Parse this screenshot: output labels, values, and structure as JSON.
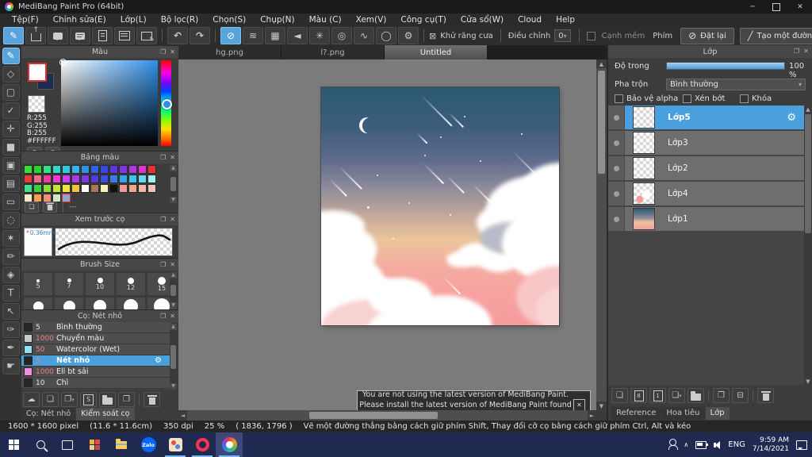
{
  "window": {
    "title": "MediBang Paint Pro (64bit)"
  },
  "menu": {
    "items": [
      "Tệp(F)",
      "Chỉnh sửa(E)",
      "Lớp(L)",
      "Bộ lọc(R)",
      "Chọn(S)",
      "Chụp(N)",
      "Màu (C)",
      "Xem(V)",
      "Công cụ(T)",
      "Cửa sổ(W)",
      "Cloud",
      "Help"
    ]
  },
  "toolbar2": {
    "antialias": "Khử răng cưa",
    "adjust_label": "Điều chỉnh",
    "adjust_value": "0",
    "soft_edge": "Cạnh mềm",
    "key_label": "Phím",
    "reset": "Đặt lại",
    "make_line": "Tạo một đường thẳng"
  },
  "panels": {
    "color": {
      "title": "Màu",
      "r": "R:255",
      "g": "G:255",
      "b": "B:255",
      "hex": "#FFFFFF"
    },
    "palette": {
      "title": "Bảng màu",
      "footer": "---",
      "selected_cell": [
        3,
        4
      ],
      "rows": [
        [
          "#35e035",
          "#2bd42b",
          "#33e089",
          "#2fd9c4",
          "#2fcadd",
          "#35b4ea",
          "#2f90e8",
          "#2f63e6",
          "#3a46e2",
          "#5a35e0",
          "#8433e0",
          "#b433e0",
          "#e033c8",
          "#e43333"
        ],
        [
          "#ea3a3a",
          "#f06a8c",
          "#f03a9e",
          "#ee3ad4",
          "#d43aee",
          "#a83ae8",
          "#7c3ae4",
          "#553ae2",
          "#3a50e2",
          "#3a7ce6",
          "#3aa4ea",
          "#3ac4ee",
          "#66d9f0",
          "#9ceef0"
        ],
        [
          "#3ee08c",
          "#3ad43a",
          "#8ade3a",
          "#c4e43a",
          "#eee43a",
          "#eec43a",
          "#ffffff",
          "#a8765a",
          "#f5efc2",
          "#101010",
          "#f09a9a",
          "#f0a88c",
          "#f5b4a8",
          "#f0c4b4"
        ],
        [
          "#f7e8c9",
          "#f5a04e",
          "#f58c7a",
          "#cfe8c9",
          "#8fa3cb"
        ]
      ]
    },
    "preview": {
      "title": "Xem trước cọ",
      "size_label": "0.36mm",
      "star": "*"
    },
    "brush_size": {
      "title": "Brush Size",
      "sizes": [
        "5",
        "7",
        "10",
        "12",
        "15"
      ]
    },
    "brushes": {
      "title": "Cọ: Nét nhỏ",
      "items": [
        {
          "size": "5",
          "name": "Bình thường",
          "swatch": "#262626",
          "red": false,
          "selected": false
        },
        {
          "size": "1000",
          "name": "Chuyển màu",
          "swatch": "#c9c9c9",
          "red": true,
          "selected": false
        },
        {
          "size": "50",
          "name": "Watercolor (Wet)",
          "swatch": "#8fe3f2",
          "red": true,
          "selected": false
        },
        {
          "size": "5",
          "name": "Nét nhỏ",
          "swatch": "#262626",
          "red": true,
          "selected": true
        },
        {
          "size": "1000",
          "name": "Ell bt sải",
          "swatch": "#f08ee6",
          "red": true,
          "selected": false
        },
        {
          "size": "10",
          "name": "Chì",
          "swatch": "#262626",
          "red": false,
          "selected": false
        }
      ],
      "tabs": [
        {
          "label": "Cọ: Nét nhỏ",
          "active": false
        },
        {
          "label": "Kiểm soát cọ",
          "active": true
        }
      ]
    }
  },
  "document_tabs": [
    {
      "label": "hg.png",
      "active": false
    },
    {
      "label": "l?.png",
      "active": false
    },
    {
      "label": "Untitled",
      "active": true
    }
  ],
  "notification": {
    "line1": "You are not using the latest version of MediBang Paint.",
    "line2": "Please install the latest version of MediBang Paint found here."
  },
  "layers": {
    "title": "Lớp",
    "opacity_label": "Độ trong",
    "opacity_value": "100 %",
    "blend_label": "Pha trộn",
    "blend_value": "Bình thường",
    "check_alpha": "Bảo vệ alpha",
    "check_clip": "Xén bớt",
    "check_lock": "Khóa",
    "items": [
      {
        "name": "Lớp5",
        "selected": true,
        "thumb": "checker"
      },
      {
        "name": "Lớp3",
        "selected": false,
        "thumb": "checker"
      },
      {
        "name": "Lớp2",
        "selected": false,
        "thumb": "checker"
      },
      {
        "name": "Lớp4",
        "selected": false,
        "thumb": "clouds"
      },
      {
        "name": "Lớp1",
        "selected": false,
        "thumb": "sky"
      }
    ],
    "tabs": [
      {
        "label": "Reference",
        "active": false
      },
      {
        "label": "Hoa tiêu",
        "active": false
      },
      {
        "label": "Lớp",
        "active": true
      }
    ]
  },
  "status": {
    "segments": [
      "1600 * 1600 pixel",
      "(11.6 * 11.6cm)",
      "350 dpi",
      "25 %",
      "( 1836, 1796 )",
      "Vẽ một đường thẳng bằng cách giữ phím Shift, Thay đổi cỡ cọ bằng cách giữ phím Ctrl, Alt và kéo"
    ]
  },
  "taskbar": {
    "zalo": "Zalo",
    "lang": "ENG",
    "time": "9:59 AM",
    "date": "7/14/2021"
  },
  "colors": {
    "accent_blue": "#4aa0dc",
    "selection_red": "#e03030",
    "taskbar_blue": "#202950"
  },
  "icons": {
    "minimize": "─",
    "close": "✕",
    "popout": "❐",
    "panel_close": "✕",
    "undo": "↶",
    "redo": "↷",
    "correction": [
      "⊘",
      "≋",
      "▦",
      "◄",
      "✳",
      "◎",
      "∿",
      "◯",
      "⚙"
    ],
    "antialias_box": "⊠",
    "dropdown": "▾",
    "prohibit": "⊘",
    "line": "╱",
    "tools": [
      "✎",
      "◇",
      "▢",
      "✓",
      "✛",
      "■",
      "▣",
      "▤",
      "▭",
      "◌",
      "✶",
      "✏",
      "◈",
      "T",
      "↖",
      "✑",
      "✒",
      "☛"
    ],
    "scroll_up": "▲",
    "scroll_down": "▼",
    "scroll_left": "◄",
    "scroll_right": "►",
    "gear": "⚙",
    "new": "❏",
    "copy": "❐",
    "merge": "⊟",
    "cloud": "☁",
    "s_doc": "S",
    "layer8": "8",
    "layer1": "1",
    "plus": "+",
    "chevron_up": "∧"
  }
}
